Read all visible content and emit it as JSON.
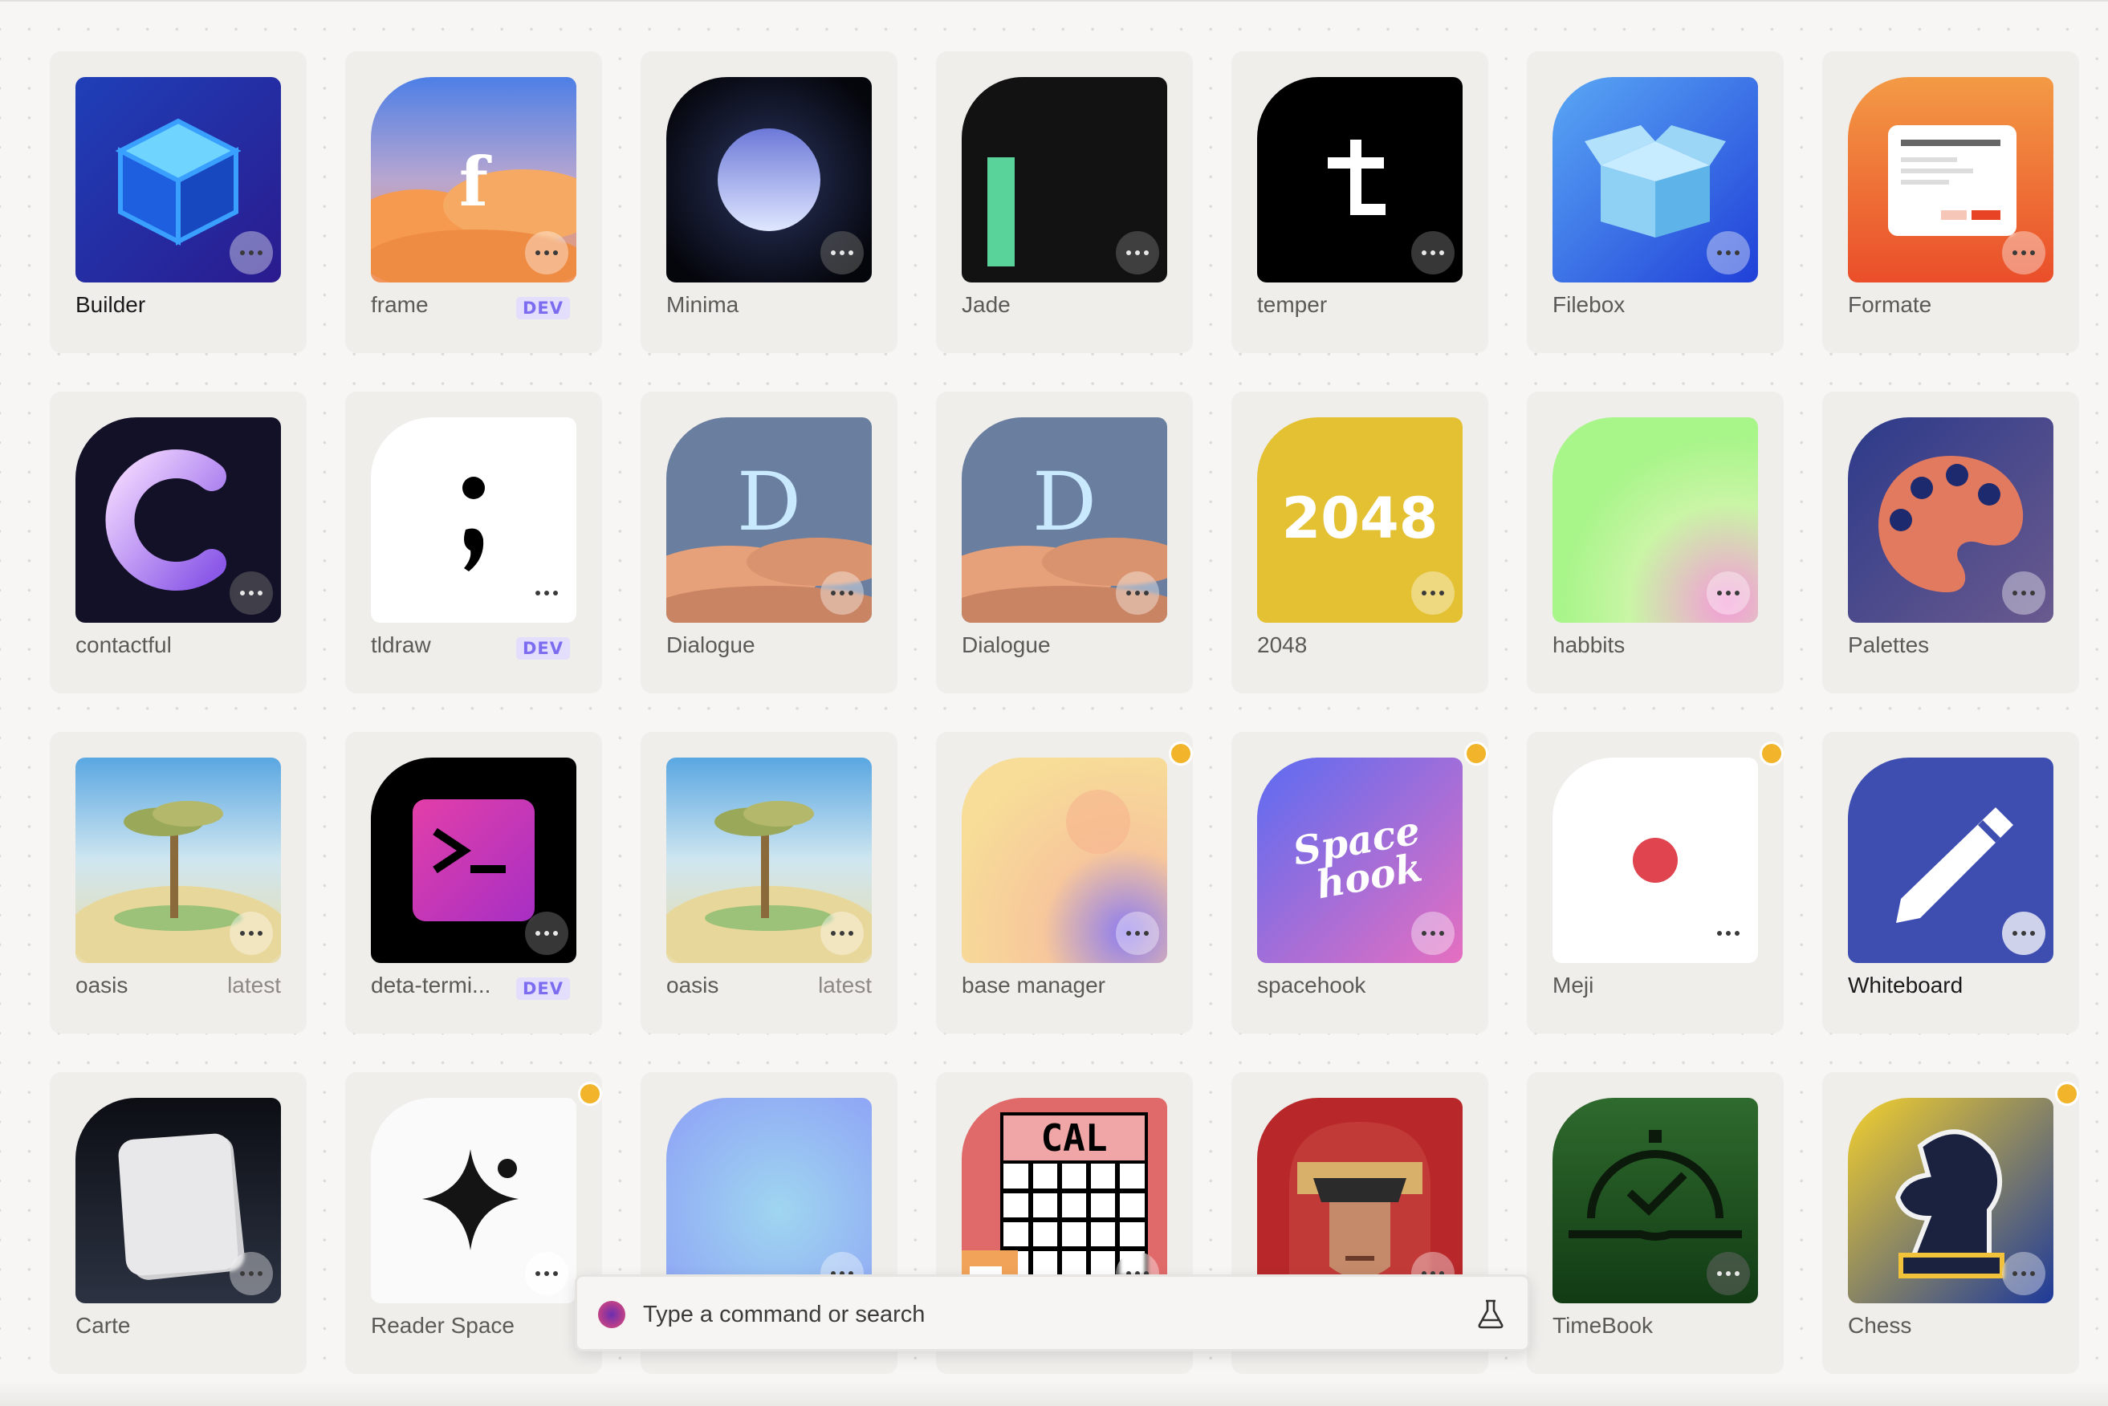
{
  "apps": [
    {
      "id": "builder",
      "label": "Builder",
      "strong": true
    },
    {
      "id": "frame",
      "label": "frame",
      "tag": "DEV"
    },
    {
      "id": "minima",
      "label": "Minima"
    },
    {
      "id": "jade",
      "label": "Jade"
    },
    {
      "id": "temper",
      "label": "temper"
    },
    {
      "id": "filebox",
      "label": "Filebox"
    },
    {
      "id": "formate",
      "label": "Formate"
    },
    {
      "id": "contactful",
      "label": "contactful"
    },
    {
      "id": "tldraw",
      "label": "tldraw",
      "tag": "DEV"
    },
    {
      "id": "dialogue1",
      "label": "Dialogue"
    },
    {
      "id": "dialogue2",
      "label": "Dialogue"
    },
    {
      "id": "game2048",
      "label": "2048",
      "icon_text": "2048"
    },
    {
      "id": "habbits",
      "label": "habbits"
    },
    {
      "id": "palettes",
      "label": "Palettes"
    },
    {
      "id": "oasis1",
      "label": "oasis",
      "tag2": "latest"
    },
    {
      "id": "deta",
      "label": "deta-termi...",
      "tag": "DEV"
    },
    {
      "id": "oasis2",
      "label": "oasis",
      "tag2": "latest"
    },
    {
      "id": "basemanager",
      "label": "base manager",
      "badge": true
    },
    {
      "id": "spacehook",
      "label": "spacehook",
      "badge": true,
      "icon_text": "Space hook"
    },
    {
      "id": "meji",
      "label": "Meji",
      "badge": true
    },
    {
      "id": "whiteboard",
      "label": "Whiteboard",
      "strong": true
    },
    {
      "id": "carte",
      "label": "Carte"
    },
    {
      "id": "readerspace",
      "label": "Reader Space",
      "badge": true
    },
    {
      "id": "blur",
      "label": ""
    },
    {
      "id": "cal",
      "label": "",
      "icon_text": "CAL"
    },
    {
      "id": "judge",
      "label": ""
    },
    {
      "id": "timebook",
      "label": "TimeBook"
    },
    {
      "id": "chess",
      "label": "Chess",
      "badge": true
    }
  ],
  "command_bar": {
    "placeholder": "Type a command or search"
  },
  "icons": {
    "more": "more-icon",
    "flask": "flask-icon",
    "command": "command-logo-icon"
  }
}
